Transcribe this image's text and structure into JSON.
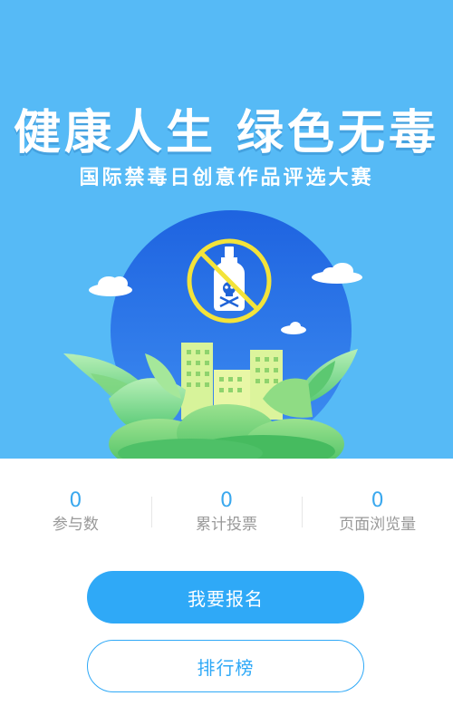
{
  "banner": {
    "title": "健康人生 绿色无毒",
    "subtitle": "国际禁毒日创意作品评选大赛",
    "illustration_icon": "no-drugs-poison-bottle"
  },
  "stats": [
    {
      "value": "0",
      "label": "参与数"
    },
    {
      "value": "0",
      "label": "累计投票"
    },
    {
      "value": "0",
      "label": "页面浏览量"
    }
  ],
  "actions": {
    "register_label": "我要报名",
    "ranking_label": "排行榜"
  },
  "colors": {
    "banner_bg": "#56baf6",
    "accent": "#2fa9f7",
    "stat_value": "#3aa8ee",
    "stat_label": "#999999"
  }
}
